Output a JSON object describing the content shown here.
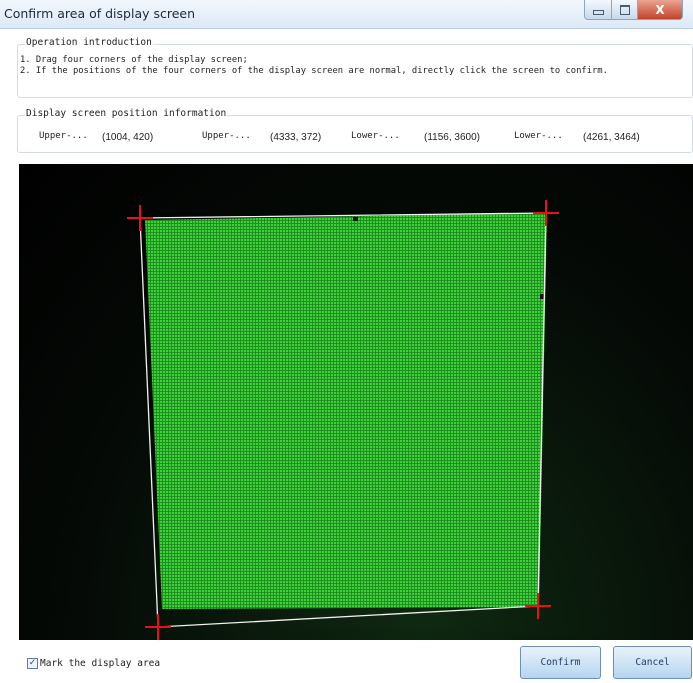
{
  "window": {
    "title": "Confirm area of display screen",
    "close_glyph": "X"
  },
  "operation": {
    "legend": "Operation introduction",
    "lines": [
      "1. Drag four corners of the display screen;",
      "2. If the positions of the four corners of the display screen are normal, directly click the screen to confirm."
    ]
  },
  "position_info": {
    "legend": "Display screen position information",
    "corners": [
      {
        "label": "Upper-...",
        "value": "(1004, 420)"
      },
      {
        "label": "Upper-...",
        "value": "(4333, 372)"
      },
      {
        "label": "Lower-...",
        "value": "(1156, 3600)"
      },
      {
        "label": "Lower-...",
        "value": "(4261, 3464)"
      }
    ]
  },
  "viewer": {
    "screen_color": "#2fbf2f",
    "marker_color": "#e8101a",
    "outline_color": "#f2f2f2"
  },
  "footer": {
    "mark_checkbox_label": "Mark the display area",
    "mark_checked": true,
    "confirm_label": "Confirm",
    "cancel_label": "Cancel"
  }
}
